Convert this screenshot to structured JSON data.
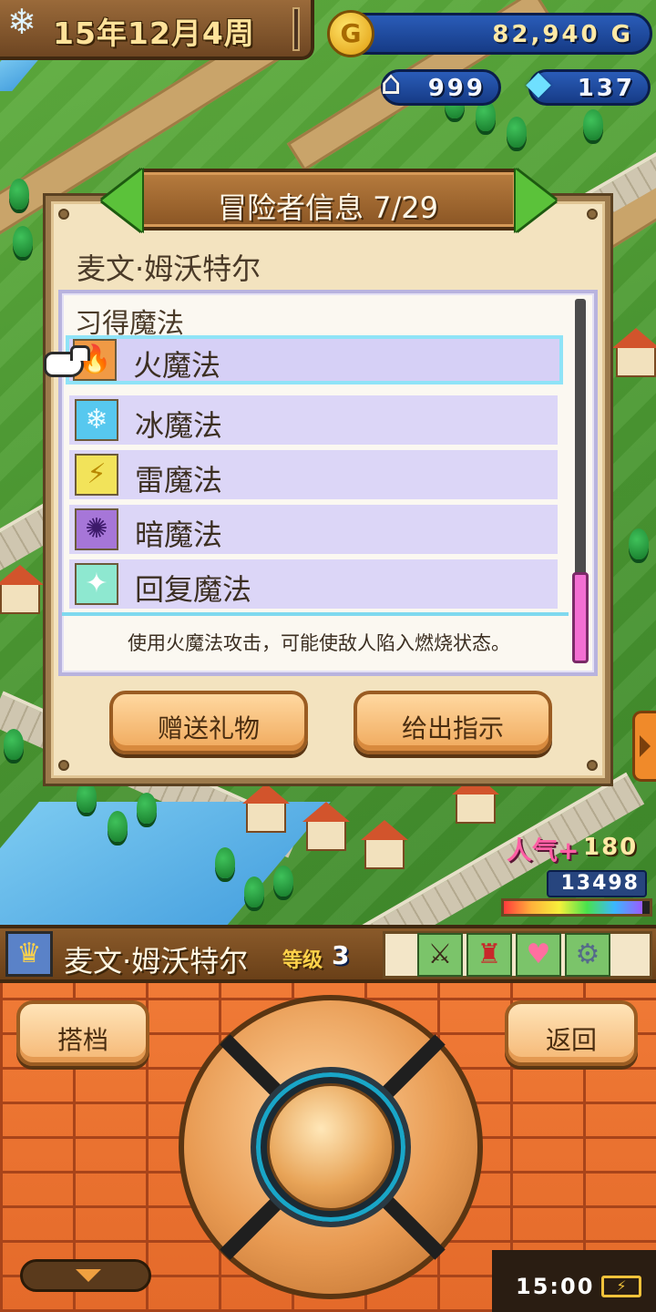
{
  "hud": {
    "date_text": "15年12月4周",
    "snow_icon": "❄",
    "gold": "82,940 G",
    "coin_symbol": "G",
    "houses": "999",
    "crystals": "137"
  },
  "dialog": {
    "title": "冒险者信息 7/29",
    "adventurer_name": "麦文·姆沃特尔",
    "magic_heading": "习得魔法",
    "magic": [
      {
        "name": "火魔法",
        "icon": "fire-icon",
        "glyph": "🔥",
        "selected": true
      },
      {
        "name": "冰魔法",
        "icon": "ice-icon",
        "glyph": "❄",
        "selected": false
      },
      {
        "name": "雷魔法",
        "icon": "thunder-icon",
        "glyph": "⚡",
        "selected": false
      },
      {
        "name": "暗魔法",
        "icon": "dark-icon",
        "glyph": "✺",
        "selected": false
      },
      {
        "name": "回复魔法",
        "icon": "heal-icon",
        "glyph": "✦",
        "selected": false
      }
    ],
    "description": "使用火魔法攻击，可能使敌人陷入燃烧状态。",
    "gift_button": "赠送礼物",
    "instruct_button": "给出指示"
  },
  "popularity": {
    "label": "人气",
    "plus": "+",
    "value": "180",
    "score": "13498",
    "gauge_level": 0.95
  },
  "character": {
    "name": "麦文·姆沃特尔",
    "level_label": "等级",
    "level": "3",
    "avatar_glyph": "♛",
    "equipment": [
      {
        "icon": "sword-icon",
        "glyph": "⚔"
      },
      {
        "icon": "armor-icon",
        "glyph": "♜"
      },
      {
        "icon": "heart-icon",
        "glyph": "♥"
      },
      {
        "icon": "bracer-icon",
        "glyph": "⚙"
      }
    ]
  },
  "controls": {
    "partner_button": "搭档",
    "back_button": "返回"
  },
  "status": {
    "clock": "15:00",
    "battery_glyph": "⚡"
  },
  "colors": {
    "dialog_bg": "#f3e3bf",
    "selected_row_border": "#8fe3f7",
    "button_orange": "#f0a95c",
    "brick": "#e46a2a"
  }
}
